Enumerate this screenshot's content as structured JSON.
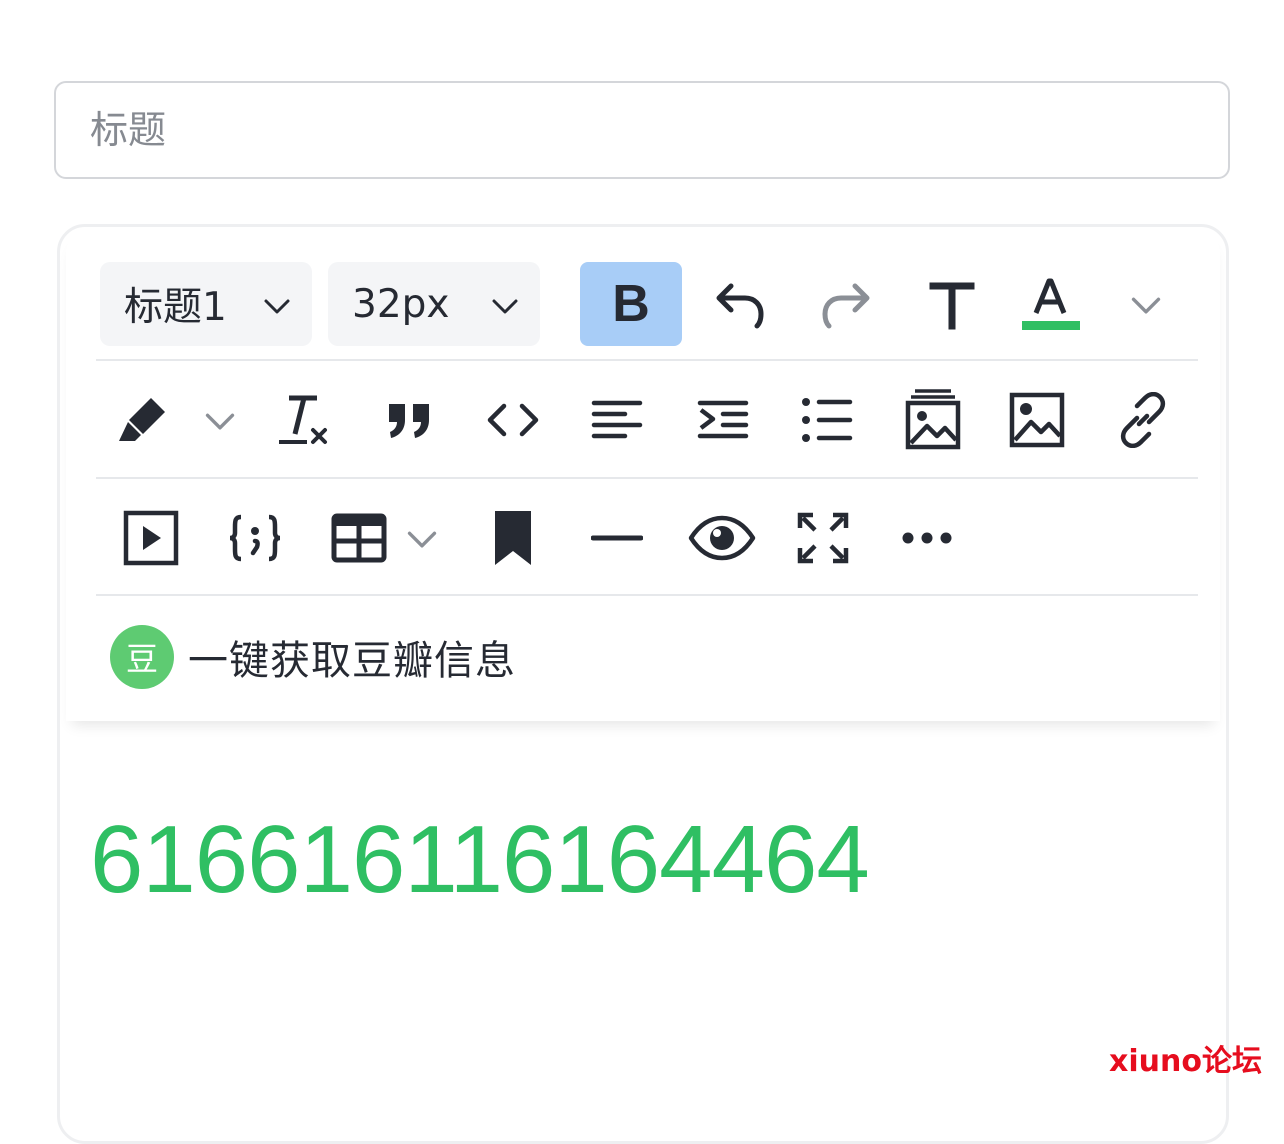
{
  "title_field": {
    "placeholder": "标题"
  },
  "toolbar": {
    "heading_select": "标题1",
    "font_size_select": "32px",
    "bold_label": "B",
    "text_color_accent": "#2fbf63",
    "active_button_bg": "#a8cdf7"
  },
  "douban": {
    "badge": "豆",
    "label": "一键获取豆瓣信息"
  },
  "editor": {
    "content": "616616116164464",
    "content_color": "#2fbf63"
  },
  "watermark": "xiuno论坛"
}
